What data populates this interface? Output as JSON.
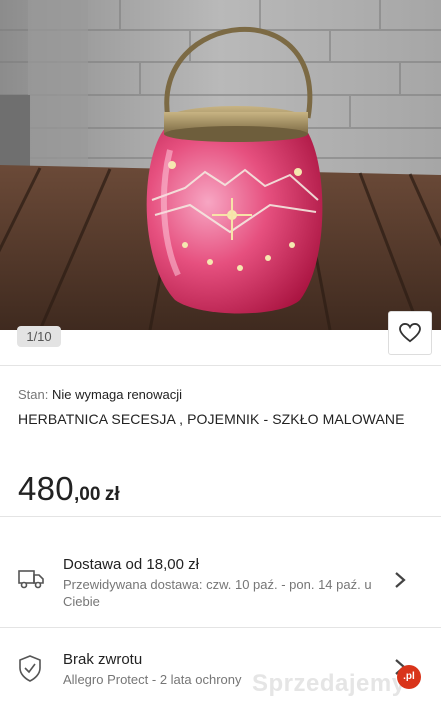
{
  "gallery": {
    "counter": "1/10",
    "favorite_icon": "heart-outline-icon",
    "photo": "pink painted glass biscuit jar with brass handle on wooden table"
  },
  "product": {
    "condition_label": "Stan:",
    "condition_value": "Nie wymaga renowacji",
    "title": "HERBATNICA SECESJA , POJEMNIK - SZKŁO MALOWANE",
    "price_int": "480",
    "price_dec": ",00",
    "currency": "zł"
  },
  "delivery": {
    "icon": "truck-icon",
    "title": "Dostawa od 18,00 zł",
    "estimate": "Przewidywana dostawa: czw. 10 paź. - pon. 14 paź. u Ciebie"
  },
  "returns": {
    "icon": "shield-check-icon",
    "title": "Brak zwrotu",
    "protection": "Allegro Protect - 2 lata ochrony"
  },
  "watermark": {
    "text": "Sprzedajemy",
    "badge": ".pl"
  },
  "colors": {
    "glass_pink": "#e23a70",
    "brass": "#9a8658",
    "wood": "#5a3b2a",
    "text": "#222222",
    "muted": "#767676"
  }
}
